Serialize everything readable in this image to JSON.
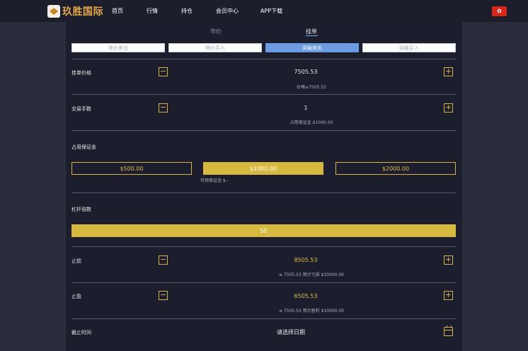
{
  "header": {
    "logo_text": "玖胜国际",
    "nav": [
      "首页",
      "行情",
      "持仓",
      "会员中心",
      "APP下载"
    ],
    "flag_glyph": "✿"
  },
  "tabs": {
    "market": "市价",
    "limit": "挂单"
  },
  "order_types": [
    "限价卖出",
    "限价买入",
    "突破卖出",
    "突破买入"
  ],
  "order_price": {
    "label": "挂单价格",
    "value": "7505.53",
    "hint": "价格≥7505.53"
  },
  "lots": {
    "label": "交易手数",
    "value": "1",
    "hint": "占用保证金 $1000.00"
  },
  "margin": {
    "label": "占用保证金",
    "options": [
      "$500.00",
      "$1000.00",
      "$2000.00"
    ],
    "available": "可用保证金 $--"
  },
  "leverage": {
    "label": "杠杆倍数",
    "value": "50"
  },
  "stop_loss": {
    "label": "止损",
    "value": "8505.53",
    "hint": "≥ 7505.53 预计亏损 $10000.00"
  },
  "take_profit": {
    "label": "止盈",
    "value": "6505.53",
    "hint": "≤ 7505.53 预计盈利 $10000.00"
  },
  "expiry": {
    "label": "截止时间",
    "placeholder": "请选择日期"
  },
  "symbols": {
    "minus": "−",
    "plus": "+"
  },
  "colors": {
    "accent_gold": "#d8b93f",
    "active_blue": "#6d9be2",
    "panel_bg": "#1c1e2d"
  }
}
